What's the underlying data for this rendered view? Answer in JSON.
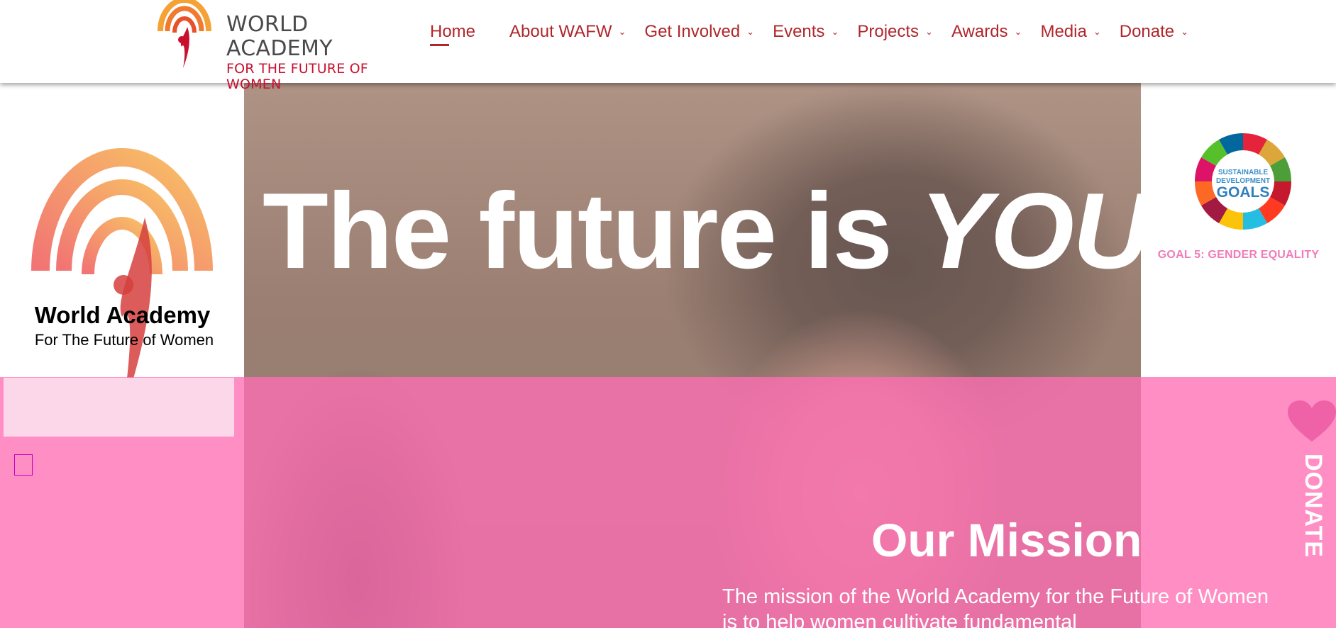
{
  "header": {
    "brand": {
      "line1": "WORLD ACADEMY",
      "line2": "FOR THE FUTURE OF WOMEN"
    },
    "nav": [
      {
        "label": "Home",
        "active": true,
        "has_dropdown": false
      },
      {
        "label": "About WAFW",
        "has_dropdown": true
      },
      {
        "label": "Get Involved",
        "has_dropdown": true
      },
      {
        "label": "Events",
        "has_dropdown": true
      },
      {
        "label": "Projects",
        "has_dropdown": true
      },
      {
        "label": "Awards",
        "has_dropdown": true
      },
      {
        "label": "Media",
        "has_dropdown": true
      },
      {
        "label": "Donate",
        "has_dropdown": true
      }
    ],
    "chevron_glyph": "⌄"
  },
  "hero": {
    "title_prefix": "The future is",
    "title_emphasis": "YOU",
    "left_logo": {
      "title": "World Academy",
      "subtitle": "For The Future of Women"
    },
    "sdg": {
      "badge_line1": "SUSTAINABLE",
      "badge_line2": "DEVELOPMENT",
      "badge_line3": "GOALS",
      "goal_label": "GOAL 5: GENDER EQUALITY"
    }
  },
  "mission": {
    "title": "Our Mission",
    "text": "The mission of the World Academy for the Future of Women is to help women cultivate fundamental"
  },
  "donate_tab": {
    "label": "DONATE",
    "icon": "heart-icon"
  },
  "colors": {
    "brand_red": "#c8102e",
    "nav_red": "#b0262b",
    "pink_overlay": "#ff6eb4",
    "pink_panel": "#fcd7ea",
    "goal_pink": "#f07bb8",
    "donate_heart": "#f062a8"
  }
}
